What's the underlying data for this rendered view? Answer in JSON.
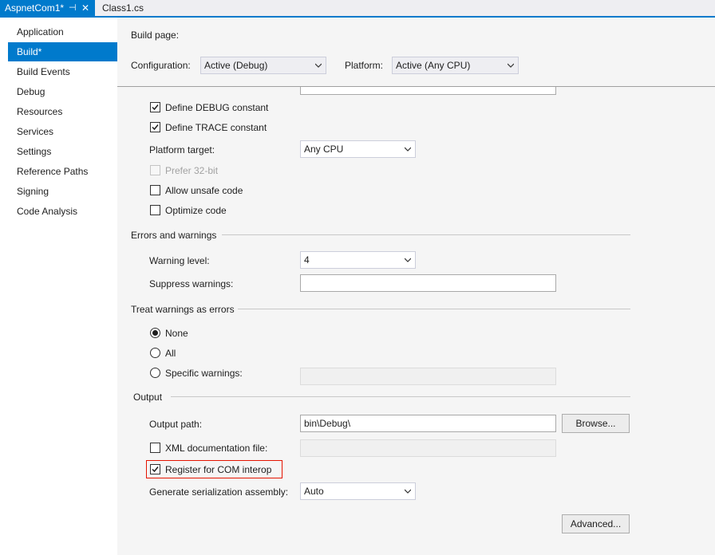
{
  "tabs": {
    "active": {
      "label": "AspnetCom1*",
      "pin_glyph": "⊣",
      "close_glyph": "✕"
    },
    "inactive": {
      "label": "Class1.cs"
    }
  },
  "nav": {
    "items": [
      {
        "label": "Application"
      },
      {
        "label": "Build*"
      },
      {
        "label": "Build Events"
      },
      {
        "label": "Debug"
      },
      {
        "label": "Resources"
      },
      {
        "label": "Services"
      },
      {
        "label": "Settings"
      },
      {
        "label": "Reference Paths"
      },
      {
        "label": "Signing"
      },
      {
        "label": "Code Analysis"
      }
    ],
    "selected_index": 1
  },
  "page": {
    "title": "Build page:",
    "configuration": {
      "label": "Configuration:",
      "value": "Active (Debug)"
    },
    "platform": {
      "label": "Platform:",
      "value": "Active (Any CPU)"
    }
  },
  "general": {
    "define_debug": {
      "label": "Define DEBUG constant",
      "checked": true
    },
    "define_trace": {
      "label": "Define TRACE constant",
      "checked": true
    },
    "platform_target": {
      "label": "Platform target:",
      "value": "Any CPU"
    },
    "prefer_32bit": {
      "label": "Prefer 32-bit",
      "checked": false,
      "enabled": false
    },
    "allow_unsafe": {
      "label": "Allow unsafe code",
      "checked": false
    },
    "optimize": {
      "label": "Optimize code",
      "checked": false
    }
  },
  "errors": {
    "heading": "Errors and warnings",
    "warning_level": {
      "label": "Warning level:",
      "value": "4"
    },
    "suppress": {
      "label": "Suppress warnings:",
      "value": ""
    }
  },
  "treat_warnings": {
    "heading": "Treat warnings as errors",
    "options": [
      {
        "label": "None",
        "selected": true
      },
      {
        "label": "All",
        "selected": false
      },
      {
        "label": "Specific warnings:",
        "selected": false
      }
    ],
    "specific_value": ""
  },
  "output": {
    "heading": "Output",
    "output_path": {
      "label": "Output path:",
      "value": "bin\\Debug\\"
    },
    "browse_label": "Browse...",
    "xml_doc": {
      "label": "XML documentation file:",
      "checked": false,
      "value": ""
    },
    "register_com": {
      "label": "Register for COM interop",
      "checked": true
    },
    "serialization": {
      "label": "Generate serialization assembly:",
      "value": "Auto"
    },
    "advanced_label": "Advanced..."
  },
  "colors": {
    "accent": "#007acc",
    "highlight_border": "#e51400",
    "content_bg": "#f5f5f5"
  }
}
